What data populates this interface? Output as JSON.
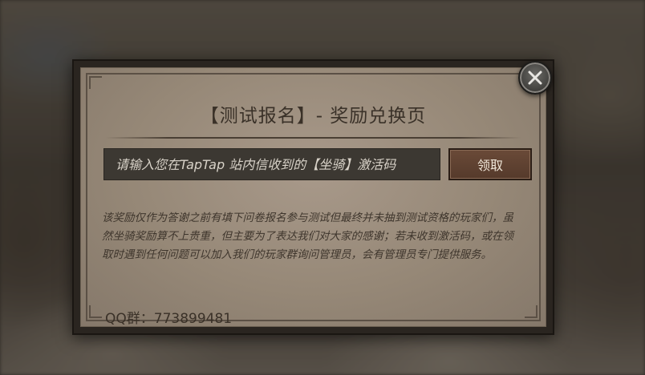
{
  "dialog": {
    "title": "【测试报名】- 奖励兑换页",
    "code_input": {
      "placeholder": "请输入您在TapTap 站内信收到的【坐骑】激活码",
      "value": ""
    },
    "claim_button_label": "领取",
    "description": "该奖励仅作为答谢之前有填下问卷报名参与测试但最终并未抽到测试资格的玩家们，虽然坐骑奖励算不上贵重，但主要为了表达我们对大家的感谢；若未收到激活码，或在领取时遇到任何问题可以加入我们的玩家群询问管理员，会有管理员专门提供服务。",
    "qq_group": "QQ群：773899481"
  },
  "icons": {
    "close": "close-icon"
  },
  "colors": {
    "panel_parchment": "#968877",
    "input_background": "#3c3832",
    "button_background": "#5e4130",
    "text_dark": "#3a3128"
  }
}
